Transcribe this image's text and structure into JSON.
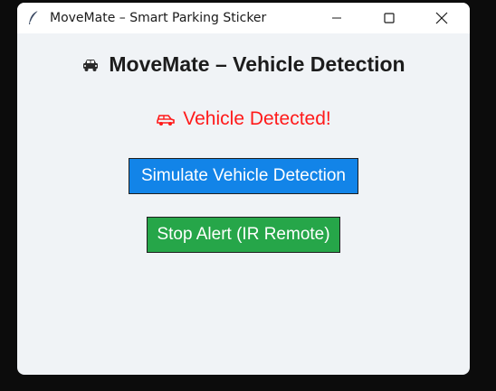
{
  "window": {
    "title": "MoveMate – Smart Parking Sticker",
    "controls": [
      "minimize-icon",
      "maximize-icon",
      "close-icon"
    ]
  },
  "main": {
    "heading": "MoveMate – Vehicle Detection",
    "heading_icon": "car-icon",
    "status_text": "Vehicle Detected!",
    "status_icon": "car-icon",
    "status_color": "#ff1a1a"
  },
  "buttons": {
    "simulate_label": "Simulate Vehicle Detection",
    "simulate_color": "#1284e8",
    "stop_label": "Stop Alert (IR Remote)",
    "stop_color": "#26a649"
  }
}
